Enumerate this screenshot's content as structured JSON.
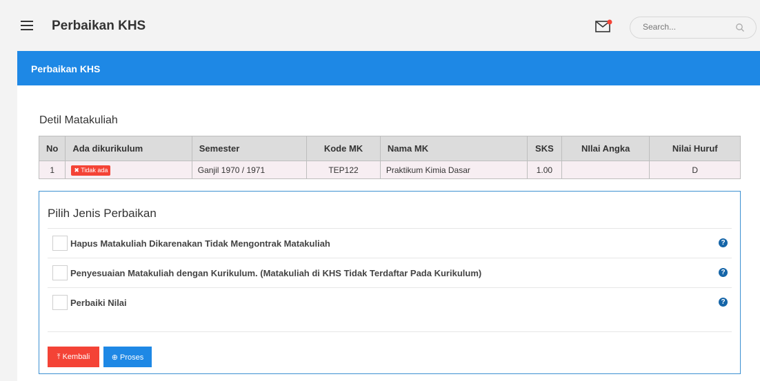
{
  "header": {
    "title": "Perbaikan KHS",
    "search_placeholder": "Search..."
  },
  "panel": {
    "title": "Perbaikan KHS"
  },
  "detail": {
    "section_title": "Detil Matakuliah",
    "columns": [
      "No",
      "Ada dikurikulum",
      "Semester",
      "Kode MK",
      "Nama MK",
      "SKS",
      "NIlai Angka",
      "Nilai Huruf"
    ],
    "row": {
      "no": "1",
      "status": "✖ Tidak ada",
      "semester": "Ganjil 1970 / 1971",
      "kode": "TEP122",
      "nama": "Praktikum Kimia Dasar",
      "sks": "1.00",
      "nilai_angka": "",
      "nilai_huruf": "D"
    }
  },
  "options": {
    "title": "Pilih Jenis Perbaikan",
    "items": [
      "Hapus Matakuliah Dikarenakan Tidak Mengontrak Matakuliah",
      "Penyesuaian Matakuliah dengan Kurikulum. (Matakuliah di KHS Tidak Terdaftar Pada Kurikulum)",
      "Perbaiki Nilai"
    ]
  },
  "buttons": {
    "back": "⤒ Kembali",
    "process": "⊕ Proses"
  },
  "colors": {
    "primary": "#1e88e5",
    "danger": "#f44336"
  }
}
